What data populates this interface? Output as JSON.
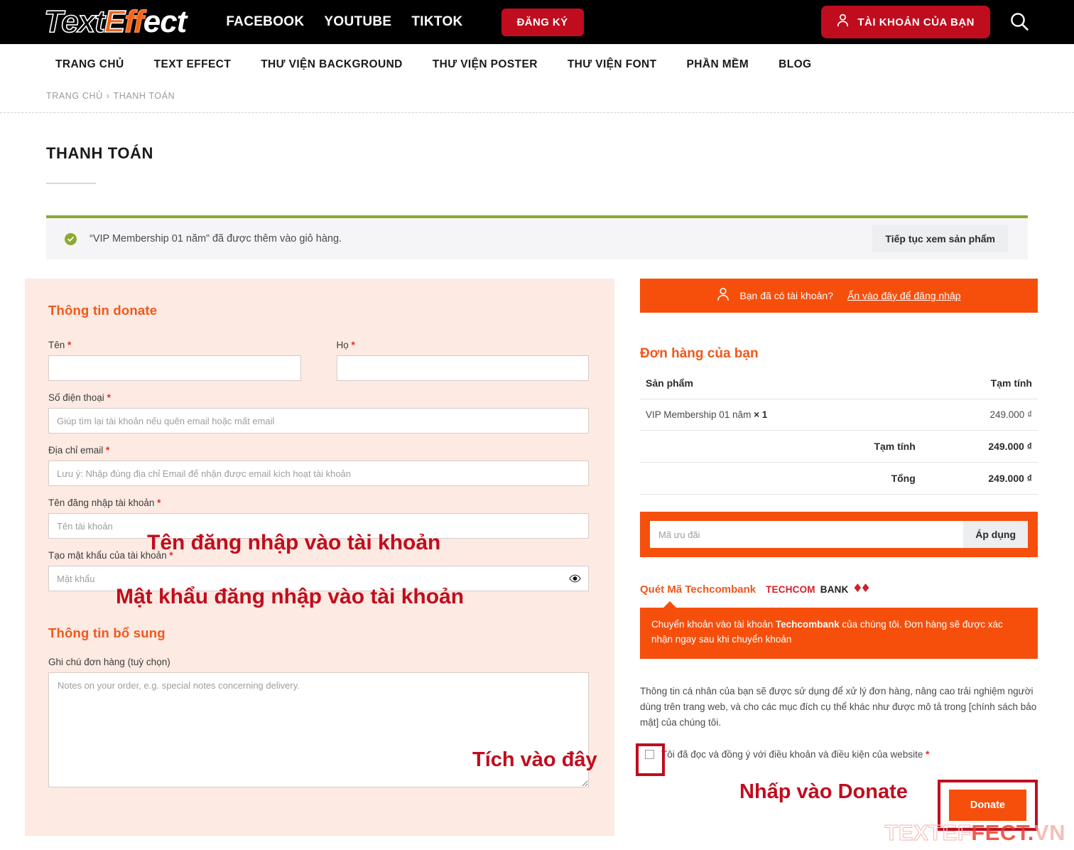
{
  "header": {
    "logo": {
      "part1": "Text",
      "part2": "E",
      "part3": "ff",
      "part4": "ect"
    },
    "social_links": [
      "FACEBOOK",
      "YOUTUBE",
      "TIKTOK"
    ],
    "signup_button": "ĐĂNG KÝ",
    "account_button": "TÀI KHOẢN CỦA BẠN",
    "search_icon": "search-icon",
    "user_icon": "user-icon"
  },
  "mainnav": {
    "items": [
      "TRANG CHỦ",
      "TEXT EFFECT",
      "THƯ VIỆN BACKGROUND",
      "THƯ VIỆN POSTER",
      "THƯ VIỆN FONT",
      "PHẦN MỀM",
      "BLOG"
    ]
  },
  "breadcrumb": {
    "home": "TRANG CHỦ",
    "separator": "›",
    "current": "THANH TOÁN"
  },
  "page": {
    "title": "THANH TOÁN"
  },
  "alert": {
    "icon": "check-circle-icon",
    "message": "“VIP Membership 01 năm” đã được thêm vào giỏ hàng.",
    "continue_button": "Tiếp tục xem sản phẩm"
  },
  "billing": {
    "heading": "Thông tin donate",
    "first_name": {
      "label": "Tên",
      "required": "*",
      "value": "",
      "placeholder": ""
    },
    "last_name": {
      "label": "Họ",
      "required": "*",
      "value": "",
      "placeholder": ""
    },
    "phone": {
      "label": "Số điện thoại",
      "required": "*",
      "value": "",
      "placeholder": "Giúp tìm lại tài khoản nếu quên email hoặc mất email"
    },
    "email": {
      "label": "Địa chỉ email",
      "required": "*",
      "value": "",
      "placeholder": "Lưu ý: Nhập đúng địa chỉ Email để nhận được email kích hoạt tài khoản"
    },
    "username": {
      "label": "Tên đăng nhập tài khoản",
      "required": "*",
      "value": "",
      "placeholder": "Tên tài khoản"
    },
    "password": {
      "label": "Tạo mật khẩu của tài khoản",
      "required": "*",
      "value": "",
      "placeholder": "Mật khẩu",
      "toggle_icon": "eye-icon"
    }
  },
  "additional": {
    "heading": "Thông tin bổ sung",
    "note": {
      "label": "Ghi chú đơn hàng (tuỳ chọn)",
      "value": "",
      "placeholder": "Notes on your order, e.g. special notes concerning delivery."
    }
  },
  "annotations": {
    "username": "Tên đăng nhập vào tài khoản",
    "password": "Mật khẩu đăng nhập vào tài khoản",
    "checkbox": "Tích vào đây",
    "donate": "Nhấp vào Donate"
  },
  "login_banner": {
    "icon": "user-icon",
    "text": "Bạn đã có tài khoản?",
    "link": "Ấn vào đây để đăng nhập"
  },
  "order": {
    "title": "Đơn hàng của bạn",
    "columns": {
      "product": "Sản phẩm",
      "subtotal": "Tạm tính"
    },
    "items": [
      {
        "name": "VIP Membership 01 năm",
        "qty": "× 1",
        "price": "249.000 ₫"
      }
    ],
    "subtotal_label": "Tạm tính",
    "subtotal_value": "249.000 ₫",
    "total_label": "Tổng",
    "total_value": "249.000 ₫"
  },
  "coupon": {
    "value": "",
    "placeholder": "Mã ưu đãi",
    "apply_button": "Áp dụng"
  },
  "payment": {
    "title": "Quét Mã Techcombank",
    "logo": {
      "part1": "TECHCOM",
      "part2": "BANK",
      "icon": "techcombank-diamond-icon"
    },
    "description_pre": "Chuyển khoản vào tài khoản ",
    "description_bold": "Techcombank",
    "description_post": " của chúng tôi. Đơn hàng sẽ được xác nhận ngay sau khi chuyển khoản"
  },
  "privacy": {
    "text": "Thông tin cá nhân của bạn sẽ được sử dụng để xử lý đơn hàng, nâng cao trải nghiệm người dùng trên trang web, và cho các mục đích cụ thể khác như được mô tả trong [chính sách bảo mật] của chúng tôi."
  },
  "terms": {
    "text": "Tôi đã đọc và đồng ý với điều khoản và điều kiện của website",
    "required": "*",
    "checked": false
  },
  "submit": {
    "label": "Donate"
  },
  "watermark": {
    "part1": "TEXTEF",
    "part2": "FECT.",
    "part3": "VN"
  },
  "colors": {
    "brand_orange": "#f64f0c",
    "brand_orange_text": "#f2571b",
    "header_black": "#000000",
    "accent_red": "#c00d1e",
    "alert_green": "#8aab2e",
    "panel_pink": "#fdeae2",
    "techcom_red": "#d32028"
  }
}
